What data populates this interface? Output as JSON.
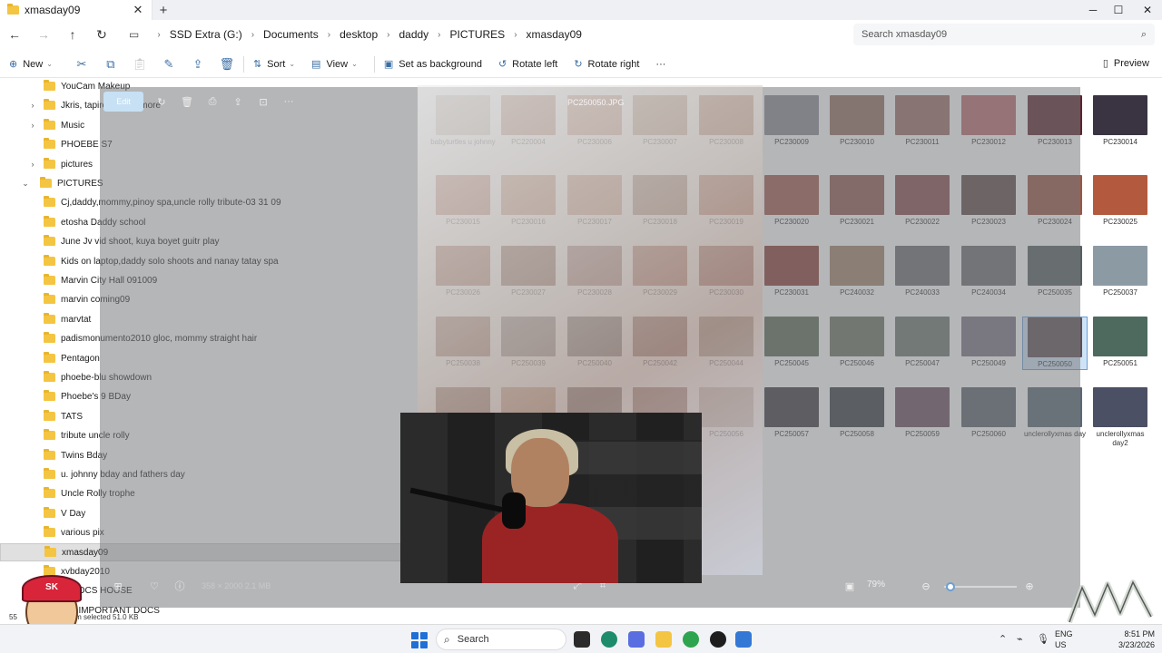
{
  "window": {
    "tab_title": "xmasday09",
    "new_tab_label": "+",
    "close_tab_label": "✕",
    "minimize_label": "─",
    "maximize_label": "☐",
    "close_label": "✕"
  },
  "address": {
    "breadcrumb": [
      "SSD Extra (G:)",
      "Documents",
      "desktop",
      "daddy",
      "PICTURES",
      "xmasday09"
    ],
    "search_placeholder": "Search xmasday09"
  },
  "commandbar": {
    "new_label": "New",
    "sort_label": "Sort",
    "view_label": "View",
    "set_background_label": "Set as background",
    "rotate_left_label": "Rotate left",
    "rotate_right_label": "Rotate right",
    "more_label": "···",
    "preview_label": "Preview"
  },
  "navpane": {
    "items": [
      {
        "label": "YouCam Makeup",
        "indent": 1,
        "chevron": "",
        "selected": false
      },
      {
        "label": "Jkris, tapiro, Kids n more",
        "indent": 1,
        "chevron": "›",
        "selected": false
      },
      {
        "label": "Music",
        "indent": 1,
        "chevron": "›",
        "selected": false
      },
      {
        "label": "PHOEBE S7",
        "indent": 1,
        "chevron": "",
        "selected": false
      },
      {
        "label": "pictures",
        "indent": 1,
        "chevron": "›",
        "selected": false
      },
      {
        "label": "PICTURES",
        "indent": 0,
        "chevron": "⌄",
        "selected": false
      },
      {
        "label": "Cj,daddy,mommy,pinoy spa,uncle rolly tribute-03 31 09",
        "indent": 1,
        "chevron": "",
        "selected": false
      },
      {
        "label": "etosha Daddy school",
        "indent": 1,
        "chevron": "",
        "selected": false
      },
      {
        "label": "June Jv vid shoot, kuya boyet guitr play",
        "indent": 1,
        "chevron": "",
        "selected": false
      },
      {
        "label": "Kids on laptop,daddy solo shoots and nanay tatay spa",
        "indent": 1,
        "chevron": "",
        "selected": false
      },
      {
        "label": "Marvin City Hall 091009",
        "indent": 1,
        "chevron": "",
        "selected": false
      },
      {
        "label": "marvin coming09",
        "indent": 1,
        "chevron": "",
        "selected": false
      },
      {
        "label": "marvtat",
        "indent": 1,
        "chevron": "",
        "selected": false
      },
      {
        "label": "padismonumento2010 gloc, mommy straight hair",
        "indent": 1,
        "chevron": "",
        "selected": false
      },
      {
        "label": "Pentagon",
        "indent": 1,
        "chevron": "",
        "selected": false
      },
      {
        "label": "phoebe-blu showdown",
        "indent": 1,
        "chevron": "",
        "selected": false
      },
      {
        "label": "Phoebe's 9 BDay",
        "indent": 1,
        "chevron": "",
        "selected": false
      },
      {
        "label": "TATS",
        "indent": 1,
        "chevron": "",
        "selected": false
      },
      {
        "label": "tribute uncle rolly",
        "indent": 1,
        "chevron": "",
        "selected": false
      },
      {
        "label": "Twins Bday",
        "indent": 1,
        "chevron": "",
        "selected": false
      },
      {
        "label": "u. johnny bday and fathers day",
        "indent": 1,
        "chevron": "",
        "selected": false
      },
      {
        "label": "Uncle Rolly trophe",
        "indent": 1,
        "chevron": "",
        "selected": false
      },
      {
        "label": "V Day",
        "indent": 1,
        "chevron": "",
        "selected": false
      },
      {
        "label": "various pix",
        "indent": 1,
        "chevron": "",
        "selected": false
      },
      {
        "label": "xmasday09",
        "indent": 1,
        "chevron": "",
        "selected": true
      },
      {
        "label": "xvbday2010",
        "indent": 1,
        "chevron": "",
        "selected": false
      },
      {
        "label": "IT DOCS HOUSE",
        "indent": 1,
        "chevron": "",
        "selected": false
      },
      {
        "label": "INE IMPORTANT DOCS",
        "indent": 1,
        "chevron": "",
        "selected": false
      }
    ]
  },
  "files": {
    "rows": [
      [
        {
          "name": "babyturtles u johnny",
          "color": "#b9a99a",
          "selected": false
        },
        {
          "name": "PC220004",
          "color": "#a0654a",
          "selected": false
        },
        {
          "name": "PC230006",
          "color": "#b5765c",
          "selected": false
        },
        {
          "name": "PC230007",
          "color": "#a77c62",
          "selected": false
        },
        {
          "name": "PC230008",
          "color": "#9e6346",
          "selected": false
        },
        {
          "name": "PC230009",
          "color": "#8c8a96",
          "selected": false
        },
        {
          "name": "PC230010",
          "color": "#946f62",
          "selected": false
        },
        {
          "name": "PC230011",
          "color": "#9a6d66",
          "selected": false
        },
        {
          "name": "PC230012",
          "color": "#b86a70",
          "selected": false
        },
        {
          "name": "PC230013",
          "color": "#5b2530",
          "selected": false
        },
        {
          "name": "PC230014",
          "color": "#3a3442",
          "selected": false
        }
      ],
      [
        {
          "name": "PC230015",
          "color": "#a65a43",
          "selected": false
        },
        {
          "name": "PC230016",
          "color": "#b07250",
          "selected": false
        },
        {
          "name": "PC230017",
          "color": "#b77a5e",
          "selected": false
        },
        {
          "name": "PC230018",
          "color": "#8c6250",
          "selected": false
        },
        {
          "name": "PC230019",
          "color": "#a45b44",
          "selected": false
        },
        {
          "name": "PC230020",
          "color": "#a25c4e",
          "selected": false
        },
        {
          "name": "PC230021",
          "color": "#8f5a50",
          "selected": false
        },
        {
          "name": "PC230022",
          "color": "#8a4c4e",
          "selected": false
        },
        {
          "name": "PC230023",
          "color": "#5e4a48",
          "selected": false
        },
        {
          "name": "PC230024",
          "color": "#9a5646",
          "selected": false
        },
        {
          "name": "PC230025",
          "color": "#b35a3e",
          "selected": false
        }
      ],
      [
        {
          "name": "PC230026",
          "color": "#8e4c3a",
          "selected": false
        },
        {
          "name": "PC230027",
          "color": "#6b3b2c",
          "selected": false
        },
        {
          "name": "PC230028",
          "color": "#8a5a58",
          "selected": false
        },
        {
          "name": "PC230029",
          "color": "#9a5545",
          "selected": false
        },
        {
          "name": "PC230030",
          "color": "#8d4a3e",
          "selected": false
        },
        {
          "name": "PC230031",
          "color": "#8a3f38",
          "selected": false
        },
        {
          "name": "PC240032",
          "color": "#a2836a",
          "selected": false
        },
        {
          "name": "PC240033",
          "color": "#6d6d72",
          "selected": false
        },
        {
          "name": "PC240034",
          "color": "#6a6e70",
          "selected": false
        },
        {
          "name": "PC250035",
          "color": "#566060",
          "selected": false
        },
        {
          "name": "PC250037",
          "color": "#8c9aa4",
          "selected": false
        }
      ],
      [
        {
          "name": "PC250038",
          "color": "#8a5a4c",
          "selected": false
        },
        {
          "name": "PC250039",
          "color": "#746a6a",
          "selected": false
        },
        {
          "name": "PC250040",
          "color": "#5a5656",
          "selected": false
        },
        {
          "name": "PC250042",
          "color": "#7d5248",
          "selected": false
        },
        {
          "name": "PC250044",
          "color": "#8a7a6c",
          "selected": false
        },
        {
          "name": "PC250045",
          "color": "#5d6a5a",
          "selected": false
        },
        {
          "name": "PC250046",
          "color": "#6a7462",
          "selected": false
        },
        {
          "name": "PC250047",
          "color": "#6e7870",
          "selected": false
        },
        {
          "name": "PC250049",
          "color": "#7a7480",
          "selected": false
        },
        {
          "name": "PC250050",
          "color": "#5e5054",
          "selected": true
        },
        {
          "name": "PC250051",
          "color": "#4e6a5e",
          "selected": false
        }
      ],
      [
        {
          "name": "",
          "color": "#7c5a4c",
          "selected": false
        },
        {
          "name": "",
          "color": "#b6896c",
          "selected": false
        },
        {
          "name": "",
          "color": "#5a4a48",
          "selected": false
        },
        {
          "name": "",
          "color": "#7a5048",
          "selected": false
        },
        {
          "name": "PC250056",
          "color": "#b6a69a",
          "selected": false
        },
        {
          "name": "PC250057",
          "color": "#3c3a40",
          "selected": false
        },
        {
          "name": "PC250058",
          "color": "#383c44",
          "selected": false
        },
        {
          "name": "PC250059",
          "color": "#6a5060",
          "selected": false
        },
        {
          "name": "PC250060",
          "color": "#5c6470",
          "selected": false
        },
        {
          "name": "unclerollyxmas day",
          "color": "#5a6874",
          "selected": false
        },
        {
          "name": "unclerollyxmas day2",
          "color": "#4c5064",
          "selected": false
        }
      ]
    ]
  },
  "viewer": {
    "filename": "PC250050.JPG",
    "edit_label": "Edit",
    "file_info": "358 × 2000   2.1 MB",
    "zoom_label": "79%"
  },
  "statusbar": {
    "item_count": "55",
    "selection_text": "1 item selected  51.0 KB"
  },
  "taskbar": {
    "search_label": "Search",
    "time": "8:51 PM",
    "date": "3/23/2026",
    "lang_top": "ENG",
    "lang_bottom": "US"
  },
  "branding": {
    "logo_text": "SK"
  }
}
